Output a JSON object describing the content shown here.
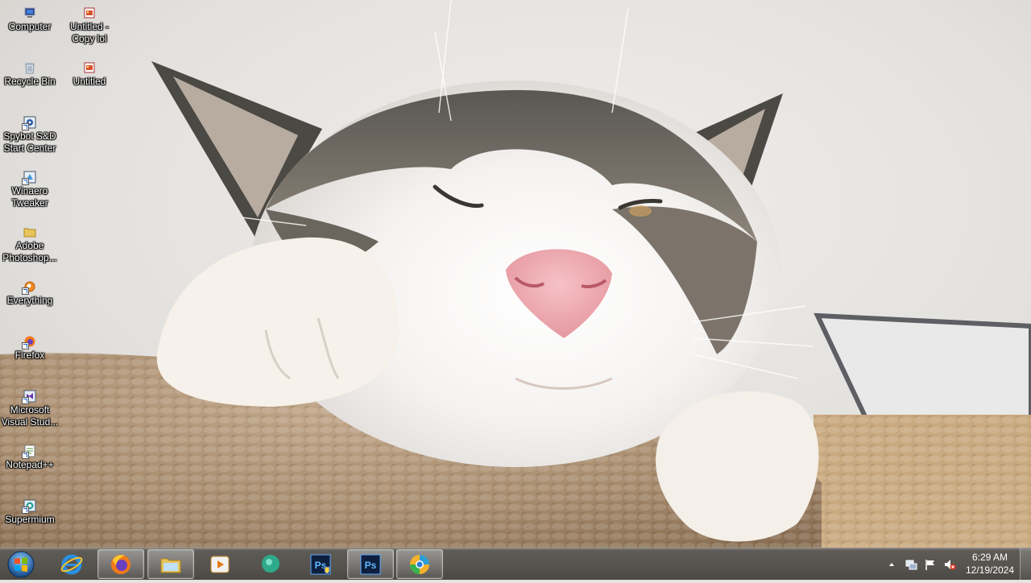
{
  "desktop": {
    "icons": [
      {
        "label": "Computer",
        "icon": "computer-icon"
      },
      {
        "label": "Untitled -\nCopy lol",
        "icon": "image-file-icon"
      },
      {
        "label": "Recycle Bin",
        "icon": "recycle-bin-icon"
      },
      {
        "label": "Untitled",
        "icon": "image-file-icon"
      },
      {
        "label": "Spybot S&D\nStart Center",
        "icon": "spybot-icon"
      },
      {
        "label": "Winaero\nTweaker",
        "icon": "winaero-icon"
      },
      {
        "label": "Adobe\nPhotoshop...",
        "icon": "folder-icon"
      },
      {
        "label": "Everything",
        "icon": "everything-icon"
      },
      {
        "label": "Firefox",
        "icon": "firefox-icon"
      },
      {
        "label": "Microsoft\nVisual Stud...",
        "icon": "visual-studio-icon"
      },
      {
        "label": "Notepad++",
        "icon": "notepadpp-icon"
      },
      {
        "label": "Supermium",
        "icon": "supermium-icon"
      }
    ]
  },
  "taskbar": {
    "start": "start-orb-icon",
    "pinned": [
      {
        "name": "internet-explorer",
        "icon": "internet-explorer-icon",
        "active": false
      },
      {
        "name": "firefox",
        "icon": "firefox-icon",
        "active": true
      },
      {
        "name": "file-explorer",
        "icon": "folder-icon",
        "active": true
      },
      {
        "name": "media-player",
        "icon": "media-player-icon",
        "active": false
      },
      {
        "name": "app-green",
        "icon": "chat-bubble-icon",
        "active": false
      },
      {
        "name": "photoshop-admin",
        "icon": "photoshop-icon",
        "active": false
      },
      {
        "name": "photoshop",
        "icon": "photoshop-icon",
        "active": true
      },
      {
        "name": "supermium",
        "icon": "supermium-icon",
        "active": true
      }
    ],
    "tray": {
      "icons": [
        "chevron-up-icon",
        "network-icon",
        "action-center-flag-icon",
        "volume-muted-icon"
      ],
      "time": "6:29 AM",
      "date": "12/19/2024"
    }
  },
  "colors": {
    "taskbar": "#56534e",
    "ps_blue": "#1b3f7a",
    "firefox_orange": "#f07a1a"
  }
}
